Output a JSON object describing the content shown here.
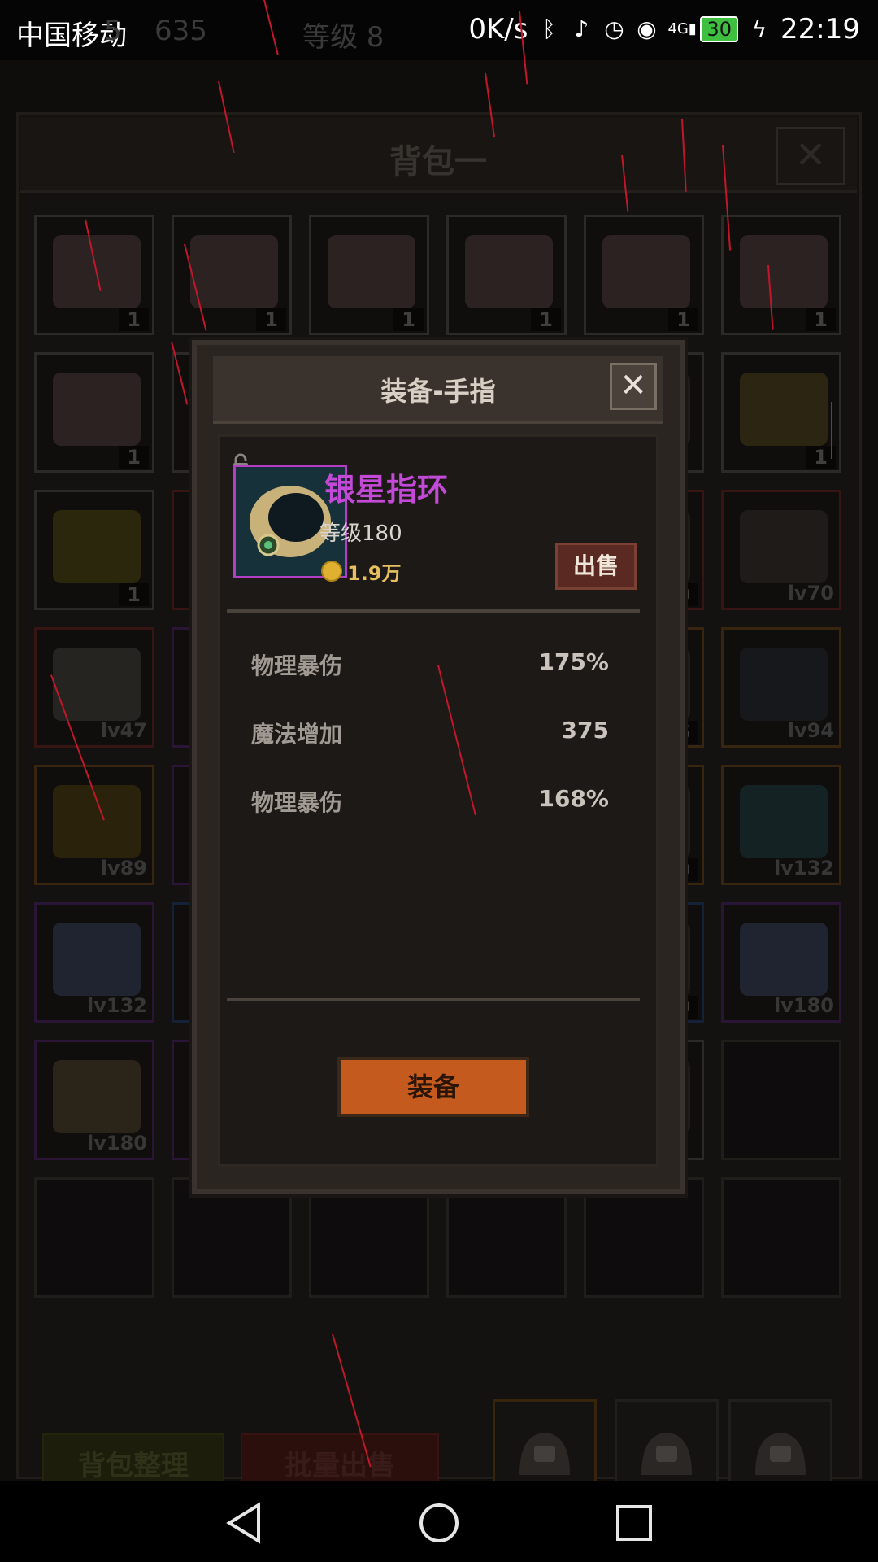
{
  "status_bar": {
    "carrier": "中国移动",
    "speed": "0K/s",
    "battery": "30",
    "time": "22:19",
    "ghost_left": "5",
    "ghost_gems": "635",
    "ghost_level": "等级 8"
  },
  "bag": {
    "title": "背包一",
    "close_label": "✕",
    "sort_label": "背包整理",
    "bulk_sell_label": "批量出售",
    "slots": [
      {
        "label": "1"
      },
      {
        "label": "1"
      },
      {
        "label": "1"
      },
      {
        "label": "1"
      },
      {
        "label": "1"
      },
      {
        "label": "1"
      },
      {
        "label": "1"
      },
      {
        "label": ""
      },
      {
        "label": ""
      },
      {
        "label": ""
      },
      {
        "label": ""
      },
      {
        "label": "1"
      },
      {
        "label": "1"
      },
      {
        "label": ""
      },
      {
        "label": ""
      },
      {
        "label": ""
      },
      {
        "label": "0"
      },
      {
        "label": "lv70"
      },
      {
        "label": "lv47"
      },
      {
        "label": ""
      },
      {
        "label": ""
      },
      {
        "label": ""
      },
      {
        "label": "6"
      },
      {
        "label": "lv94"
      },
      {
        "label": "lv89"
      },
      {
        "label": ""
      },
      {
        "label": ""
      },
      {
        "label": ""
      },
      {
        "label": "0"
      },
      {
        "label": "lv132"
      },
      {
        "label": "lv132"
      },
      {
        "label": ""
      },
      {
        "label": ""
      },
      {
        "label": ""
      },
      {
        "label": "0"
      },
      {
        "label": "lv180"
      },
      {
        "label": "lv180"
      },
      {
        "label": ""
      },
      {
        "label": ""
      },
      {
        "label": ""
      },
      {
        "label": ""
      },
      {
        "label": ""
      },
      {
        "label": ""
      },
      {
        "label": ""
      },
      {
        "label": ""
      },
      {
        "label": ""
      },
      {
        "label": ""
      },
      {
        "label": ""
      }
    ]
  },
  "dialog": {
    "title": "装备-手指",
    "close_label": "✕",
    "item_name": "银星指环",
    "level_text": "等级180",
    "price": "1.9万",
    "sell_label": "出售",
    "stats": [
      {
        "name": "物理暴伤",
        "value": "175%"
      },
      {
        "name": "魔法增加",
        "value": "375"
      },
      {
        "name": "物理暴伤",
        "value": "168%"
      }
    ],
    "equip_label": "装备"
  },
  "colors": {
    "item_name": "#c24ad6",
    "equip_button": "#c55a1e",
    "rain": "#c0182a"
  }
}
